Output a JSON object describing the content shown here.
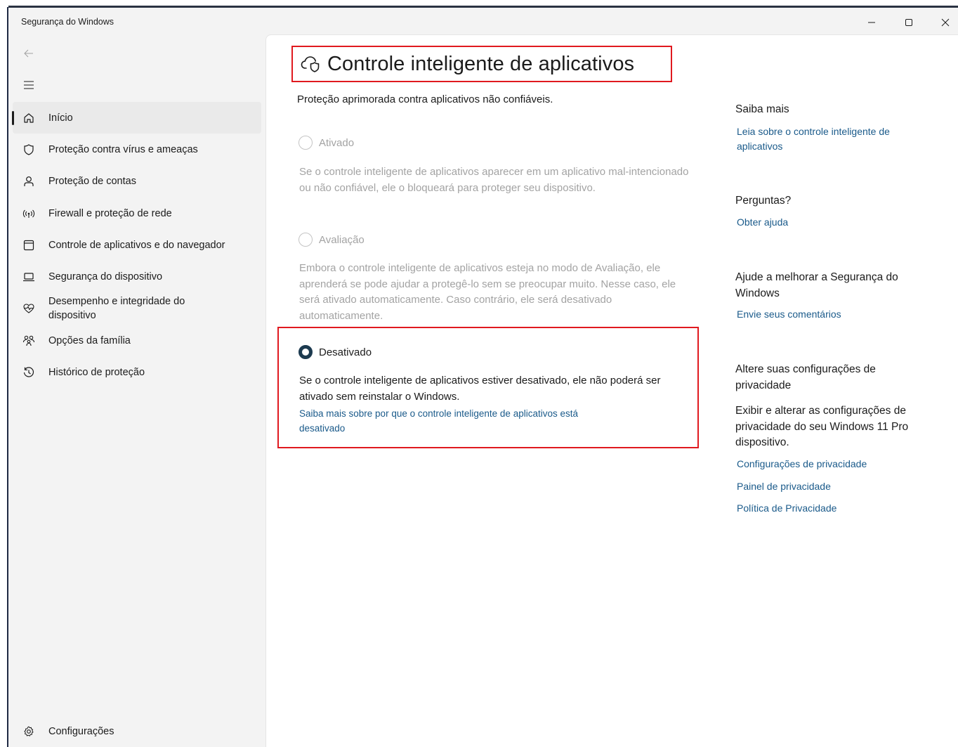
{
  "window": {
    "title": "Segurança do Windows"
  },
  "nav": {
    "items": [
      {
        "label": "Início",
        "icon": "home-icon"
      },
      {
        "label": "Proteção contra vírus e ameaças",
        "icon": "shield-icon"
      },
      {
        "label": "Proteção de contas",
        "icon": "person-icon"
      },
      {
        "label": "Firewall e proteção de rede",
        "icon": "wifi-signal-icon"
      },
      {
        "label": "Controle de aplicativos e do navegador",
        "icon": "app-window-icon"
      },
      {
        "label": "Segurança do dispositivo",
        "icon": "laptop-icon"
      },
      {
        "label": "Desempenho e integridade do dispositivo",
        "icon": "heart-pulse-icon"
      },
      {
        "label": "Opções da família",
        "icon": "family-icon"
      },
      {
        "label": "Histórico de proteção",
        "icon": "history-icon"
      }
    ],
    "settings_label": "Configurações"
  },
  "main": {
    "title": "Controle inteligente de aplicativos",
    "subtitle": "Proteção aprimorada contra aplicativos não confiáveis.",
    "options": {
      "on": {
        "label": "Ativado",
        "description": "Se o controle inteligente de aplicativos aparecer em um aplicativo mal-intencionado ou não confiável, ele o bloqueará para proteger seu dispositivo."
      },
      "eval": {
        "label": "Avaliação",
        "description": "Embora o controle inteligente de aplicativos esteja no modo de Avaliação, ele aprenderá se pode ajudar a protegê-lo sem se preocupar muito. Nesse caso, ele será ativado automaticamente. Caso contrário, ele será desativado automaticamente."
      },
      "off": {
        "label": "Desativado",
        "description": "Se o controle inteligente de aplicativos estiver desativado, ele não poderá ser ativado sem reinstalar o Windows.",
        "link": "Saiba mais sobre por que o controle inteligente de aplicativos está desativado"
      }
    },
    "selected": "Desativado"
  },
  "side": {
    "learn_more": {
      "heading": "Saiba mais",
      "link": "Leia sobre o controle inteligente de aplicativos"
    },
    "questions": {
      "heading": "Perguntas?",
      "link": "Obter ajuda"
    },
    "feedback": {
      "heading": "Ajude a melhorar a Segurança do Windows",
      "link": "Envie seus comentários"
    },
    "privacy": {
      "heading": "Altere suas configurações de privacidade",
      "text": "Exibir e alterar as configurações de privacidade do seu Windows 11 Pro dispositivo.",
      "links": [
        "Configurações de privacidade",
        "Painel de privacidade",
        "Política de Privacidade"
      ]
    }
  },
  "colors": {
    "highlight": "#e0191f",
    "link": "#1a5a8a",
    "radio_checked": "#1c3a4f",
    "sidebar_bg": "#f3f3f3",
    "content_bg": "#ffffff"
  }
}
